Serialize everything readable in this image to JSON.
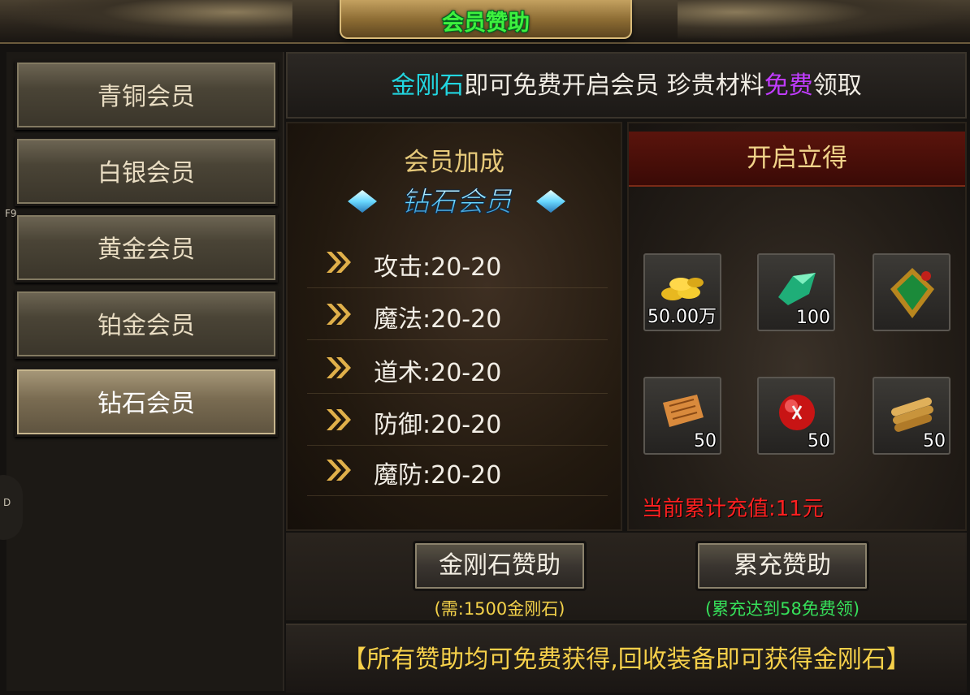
{
  "window": {
    "title": "会员赞助"
  },
  "sidebar": {
    "items": [
      {
        "label": "青铜会员",
        "active": false
      },
      {
        "label": "白银会员",
        "active": false
      },
      {
        "label": "黄金会员",
        "active": false
      },
      {
        "label": "铂金会员",
        "active": false
      },
      {
        "label": "钻石会员",
        "active": true
      }
    ],
    "hotkey_f9": "F9",
    "hotkey_d": "D"
  },
  "banner": {
    "part1": "金刚石",
    "part2": "即可免费开启会员 珍贵材料",
    "part3": "免费",
    "part4": "领取"
  },
  "bonus": {
    "title": "会员加成",
    "tier_logo_text": "钻石会员",
    "stats": [
      {
        "label": "攻击:20-20"
      },
      {
        "label": "魔法:20-20"
      },
      {
        "label": "道术:20-20"
      },
      {
        "label": "防御:20-20"
      },
      {
        "label": "魔防:20-20"
      }
    ]
  },
  "rewards": {
    "header": "开启立得",
    "items": [
      {
        "icon": "gold-coins-icon",
        "qty": "50.00万"
      },
      {
        "icon": "green-gem-icon",
        "qty": "100"
      },
      {
        "icon": "green-medal-icon",
        "qty": ""
      },
      {
        "icon": "scroll-icon",
        "qty": "50"
      },
      {
        "icon": "red-orb-icon",
        "qty": "50"
      },
      {
        "icon": "bamboo-scroll-icon",
        "qty": "50"
      }
    ],
    "recharge_text": "当前累计充值:11元"
  },
  "actions": {
    "diamond_button": "金刚石赞助",
    "diamond_note": "(需:1500金刚石)",
    "recharge_button": "累充赞助",
    "recharge_note": "(累充达到58免费领)"
  },
  "footer": {
    "text": "【所有赞助均可免费获得,回收装备即可获得金刚石】"
  },
  "colors": {
    "title_green": "#3ef03e",
    "accent_cyan": "#22d6e0",
    "accent_purple": "#c13cff",
    "warn_red": "#ff2020",
    "note_yellow": "#f4d24a",
    "note_green": "#36e05a"
  }
}
